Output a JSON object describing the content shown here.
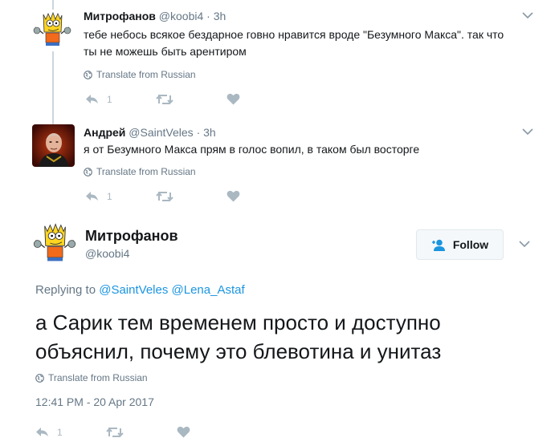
{
  "replies": [
    {
      "name": "Митрофанов",
      "handle": "@koobi4",
      "dot": "·",
      "time": "3h",
      "text": "тебе небось всякое бездарное говно нравится вроде \"Безумного Макса\". так что ты не можешь быть арентиром",
      "translate": "Translate from Russian",
      "reply_count": "1"
    },
    {
      "name": "Андрей",
      "handle": "@SaintVeles",
      "dot": "·",
      "time": "3h",
      "text": "я от Безумного Макса прям в голос вопил, в таком был восторге",
      "translate": "Translate from Russian",
      "reply_count": "1"
    }
  ],
  "main": {
    "name": "Митрофанов",
    "handle": "@koobi4",
    "follow_label": "Follow",
    "replying_prefix": "Replying to",
    "replying_to": [
      "@SaintVeles",
      "@Lena_Astaf"
    ],
    "text": "а Сарик тем временем просто и доступно объяснил, почему это блевотина и унитаз",
    "translate": "Translate from Russian",
    "timestamp": "12:41 PM - 20 Apr 2017",
    "reply_count": "1"
  },
  "colors": {
    "link": "#1b95e0",
    "secondary": "#657786",
    "action_icon": "#aab8c2",
    "thread_line": "#ccd6dd"
  },
  "icons": [
    "bart-avatar",
    "andrey-avatar",
    "globe-icon",
    "reply-icon",
    "retweet-icon",
    "heart-icon",
    "chevron-down-icon",
    "follow-person-icon"
  ]
}
